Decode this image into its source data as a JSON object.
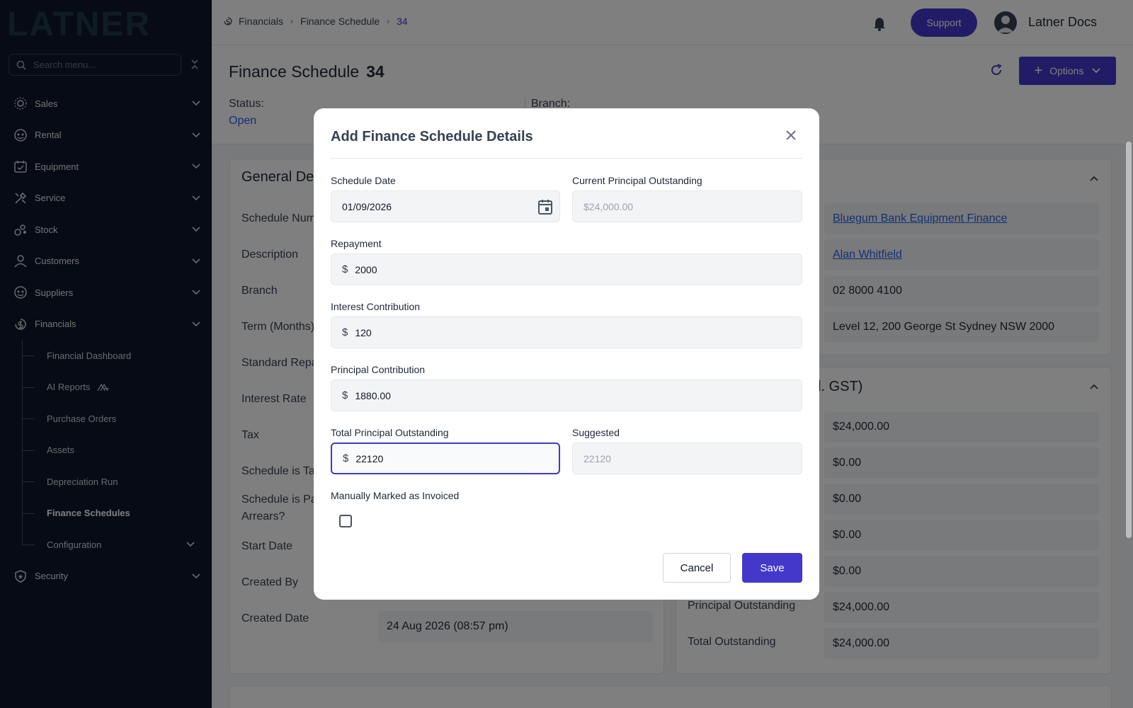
{
  "colors": {
    "sidebar_bg": "#0f172a",
    "accent": "#4338ca",
    "link": "#2563eb"
  },
  "sidebar": {
    "logo_text": "LATNER",
    "search_placeholder": "Search menu...",
    "items": [
      {
        "label": "Sales",
        "icon": "sales-icon"
      },
      {
        "label": "Rental",
        "icon": "rental-icon"
      },
      {
        "label": "Equipment",
        "icon": "equipment-icon"
      },
      {
        "label": "Service",
        "icon": "service-icon"
      },
      {
        "label": "Stock",
        "icon": "stock-icon"
      },
      {
        "label": "Customers",
        "icon": "customers-icon"
      },
      {
        "label": "Suppliers",
        "icon": "suppliers-icon"
      },
      {
        "label": "Financials",
        "icon": "financials-icon"
      }
    ],
    "financials_sub": [
      {
        "label": "Financial Dashboard"
      },
      {
        "label": "AI Reports"
      },
      {
        "label": "Purchase Orders"
      },
      {
        "label": "Assets"
      },
      {
        "label": "Depreciation Run"
      },
      {
        "label": "Finance Schedules"
      },
      {
        "label": "Configuration"
      }
    ],
    "security": {
      "label": "Security",
      "icon": "security-icon"
    }
  },
  "topbar": {
    "breadcrumb": [
      "Financials",
      "Finance Schedule",
      "34"
    ],
    "support_label": "Support",
    "user_name": "Latner Docs"
  },
  "page": {
    "title": "Finance Schedule",
    "number": "34",
    "options_label": "Options",
    "status_label": "Status:",
    "status_value": "Open",
    "branch_label": "Branch:"
  },
  "general": {
    "title": "General Det",
    "labels": [
      "Schedule Num",
      "Description",
      "Branch",
      "Term (Months)",
      "Standard Repa",
      "Interest Rate",
      "Tax",
      "Schedule is Ta",
      "Schedule is Pa",
      "Arrears?",
      "Start Date",
      "Created By",
      "Created Date"
    ],
    "created_date": "24 Aug 2026 (08:57 pm)"
  },
  "supplier": {
    "finance_company": "Bluegum Bank Equipment Finance",
    "contact": "Alan Whitfield",
    "phone": "02 8000 4100",
    "address": "Level 12, 200 George St Sydney NSW 2000"
  },
  "totals": {
    "title": "cl. GST)",
    "values": [
      "$24,000.00",
      "$0.00",
      "$0.00",
      "$0.00",
      "$0.00"
    ],
    "principal_outstanding_label": "Principal Outstanding",
    "principal_outstanding": "$24,000.00",
    "total_outstanding_label": "Total Outstanding",
    "total_outstanding": "$24,000.00"
  },
  "modal": {
    "title": "Add Finance Schedule Details",
    "schedule_date_label": "Schedule Date",
    "schedule_date": "01/09/2026",
    "current_principal_label": "Current Principal Outstanding",
    "current_principal_placeholder": "$24,000.00",
    "repayment_label": "Repayment",
    "repayment": "2000",
    "interest_label": "Interest Contribution",
    "interest": "120",
    "principal_label": "Principal Contribution",
    "principal": "1880.00",
    "total_principal_label": "Total Principal Outstanding",
    "total_principal": "22120",
    "suggested_label": "Suggested",
    "suggested": "22120",
    "invoiced_label": "Manually Marked as Invoiced",
    "invoiced_checked": false,
    "currency": "$",
    "cancel_label": "Cancel",
    "save_label": "Save"
  }
}
